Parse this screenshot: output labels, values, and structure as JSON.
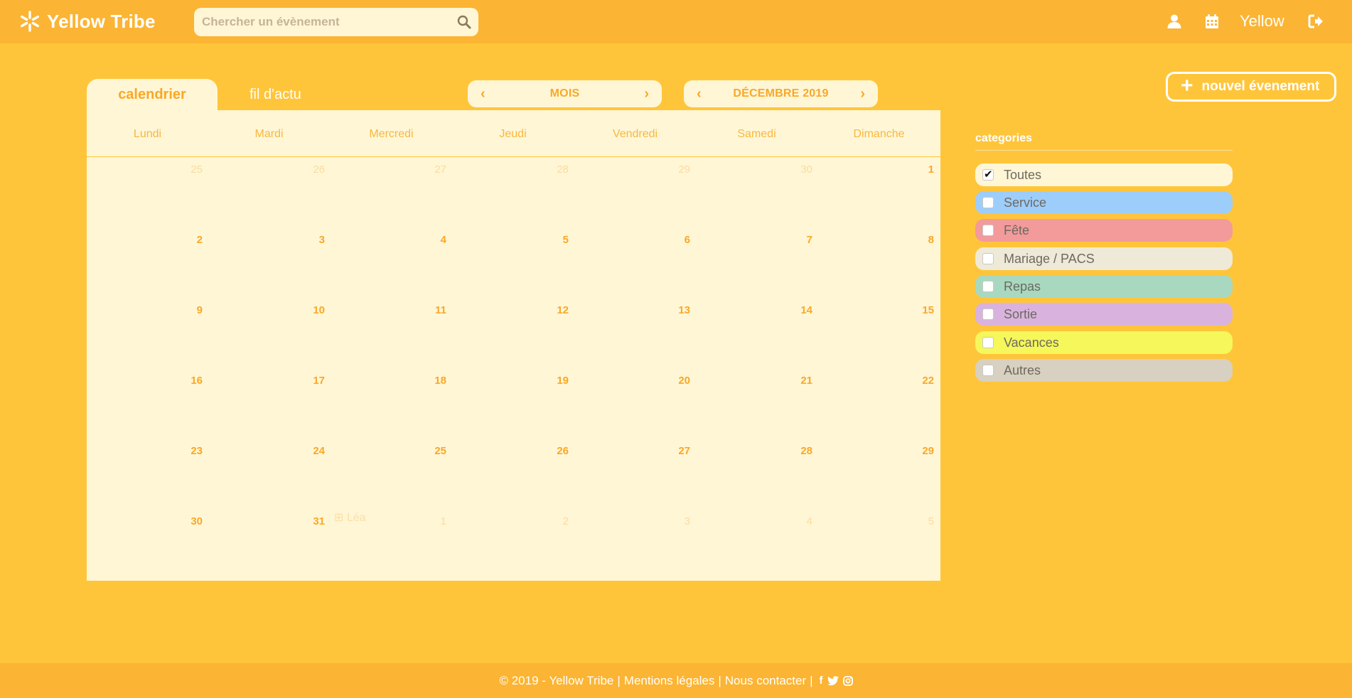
{
  "app": {
    "name": "Yellow Tribe"
  },
  "search": {
    "placeholder": "Chercher un évènement"
  },
  "header": {
    "user_name": "Yellow"
  },
  "tabs": [
    {
      "label": "calendrier",
      "active": true
    },
    {
      "label": "fil d'actu",
      "active": false
    }
  ],
  "view_nav": {
    "label": "MOIS"
  },
  "month_nav": {
    "label": "DÉCEMBRE 2019"
  },
  "new_event": {
    "label": "nouvel évenement"
  },
  "calendar": {
    "weekdays": [
      "Lundi",
      "Mardi",
      "Mercredi",
      "Jeudi",
      "Vendredi",
      "Samedi",
      "Dimanche"
    ],
    "weeks": [
      [
        {
          "d": "25",
          "muted": true
        },
        {
          "d": "26",
          "muted": true
        },
        {
          "d": "27",
          "muted": true
        },
        {
          "d": "28",
          "muted": true
        },
        {
          "d": "29",
          "muted": true
        },
        {
          "d": "30",
          "muted": true
        },
        {
          "d": "1",
          "muted": false
        }
      ],
      [
        {
          "d": "2",
          "muted": false
        },
        {
          "d": "3",
          "muted": false
        },
        {
          "d": "4",
          "muted": false
        },
        {
          "d": "5",
          "muted": false
        },
        {
          "d": "6",
          "muted": false
        },
        {
          "d": "7",
          "muted": false
        },
        {
          "d": "8",
          "muted": false
        }
      ],
      [
        {
          "d": "9",
          "muted": false
        },
        {
          "d": "10",
          "muted": false
        },
        {
          "d": "11",
          "muted": false
        },
        {
          "d": "12",
          "muted": false
        },
        {
          "d": "13",
          "muted": false
        },
        {
          "d": "14",
          "muted": false
        },
        {
          "d": "15",
          "muted": false
        }
      ],
      [
        {
          "d": "16",
          "muted": false
        },
        {
          "d": "17",
          "muted": false
        },
        {
          "d": "18",
          "muted": false
        },
        {
          "d": "19",
          "muted": false
        },
        {
          "d": "20",
          "muted": false
        },
        {
          "d": "21",
          "muted": false
        },
        {
          "d": "22",
          "muted": false
        }
      ],
      [
        {
          "d": "23",
          "muted": false
        },
        {
          "d": "24",
          "muted": false
        },
        {
          "d": "25",
          "muted": false
        },
        {
          "d": "26",
          "muted": false
        },
        {
          "d": "27",
          "muted": false
        },
        {
          "d": "28",
          "muted": false
        },
        {
          "d": "29",
          "muted": false
        }
      ],
      [
        {
          "d": "30",
          "muted": false
        },
        {
          "d": "31",
          "muted": false
        },
        {
          "d": "1",
          "muted": true
        },
        {
          "d": "2",
          "muted": true
        },
        {
          "d": "3",
          "muted": true
        },
        {
          "d": "4",
          "muted": true
        },
        {
          "d": "5",
          "muted": true
        }
      ]
    ],
    "event": {
      "label": "Léa",
      "icon": "cake-icon"
    }
  },
  "categories": {
    "title": "categories",
    "items": [
      {
        "label": "Toutes",
        "checked": true,
        "color": "#fff6d6"
      },
      {
        "label": "Service",
        "checked": false,
        "color": "#9dcdfb"
      },
      {
        "label": "Fête",
        "checked": false,
        "color": "#f39a9b"
      },
      {
        "label": "Mariage / PACS",
        "checked": false,
        "color": "#efe9d8"
      },
      {
        "label": "Repas",
        "checked": false,
        "color": "#a8d9c0"
      },
      {
        "label": "Sortie",
        "checked": false,
        "color": "#d9b3de"
      },
      {
        "label": "Vacances",
        "checked": false,
        "color": "#f5f75a"
      },
      {
        "label": "Autres",
        "checked": false,
        "color": "#d8d0c0"
      }
    ]
  },
  "footer": {
    "copyright": "© 2019 - Yellow Tribe",
    "legal": "Mentions légales",
    "contact": "Nous contacter"
  },
  "colors": {
    "background": "#ffc53a",
    "header": "#fbb433",
    "panel": "#fff6d6",
    "accent": "#f9a826"
  }
}
